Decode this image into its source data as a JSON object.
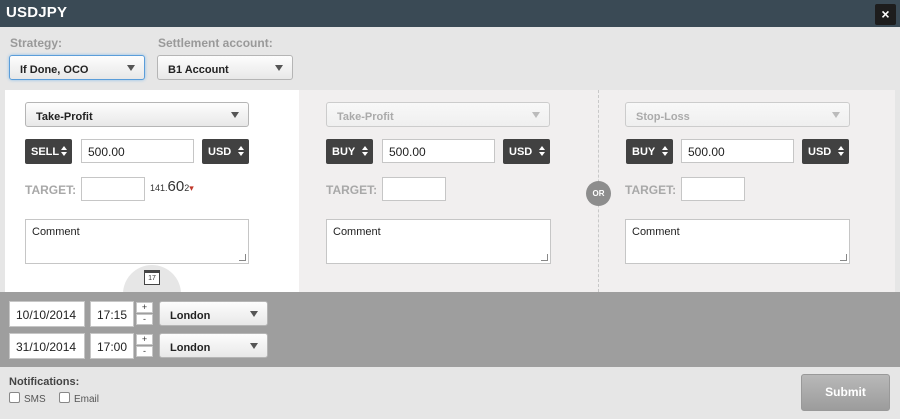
{
  "window": {
    "title": "USDJPY",
    "close_label": "×"
  },
  "strategy": {
    "label": "Strategy:",
    "value": "If Done, OCO"
  },
  "settlement": {
    "label": "Settlement account:",
    "value": "B1 Account"
  },
  "left_order": {
    "type": "Take-Profit",
    "side": "SELL",
    "amount": "500.00",
    "currency": "USD",
    "target_label": "TARGET:",
    "target_value": "",
    "price_prefix": "141.",
    "price_main": "60",
    "price_pip": "2",
    "price_tick": "❤",
    "comment_placeholder": "Comment"
  },
  "mid_order": {
    "type": "Take-Profit",
    "side": "BUY",
    "amount": "500.00",
    "currency": "USD",
    "target_label": "TARGET:",
    "target_value": "",
    "comment_placeholder": "Comment"
  },
  "or_label": "OR",
  "right_order": {
    "type": "Stop-Loss",
    "side": "BUY",
    "amount": "500.00",
    "currency": "USD",
    "target_label": "TARGET:",
    "target_value": "",
    "comment_placeholder": "Comment"
  },
  "calendar_icon_text": "17",
  "validity": [
    {
      "date": "10/10/2014",
      "time": "17:15",
      "plus": "+",
      "minus": "-",
      "zone": "London"
    },
    {
      "date": "31/10/2014",
      "time": "17:00",
      "plus": "+",
      "minus": "-",
      "zone": "London"
    }
  ],
  "notifications": {
    "label": "Notifications:",
    "sms": "SMS",
    "email": "Email"
  },
  "submit_label": "Submit",
  "colors": {
    "titlebar": "#3a4a55",
    "dark_button": "#414141",
    "date_bar": "#9e9e9e"
  }
}
